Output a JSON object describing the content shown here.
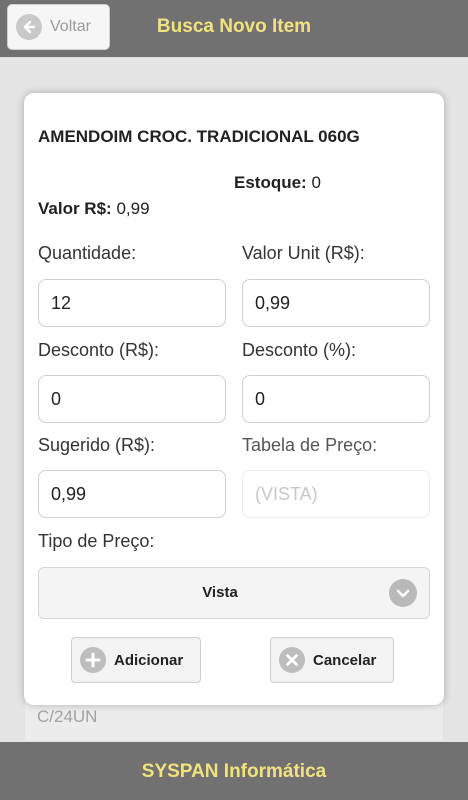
{
  "header": {
    "back_label": "Voltar",
    "title": "Busca Novo Item"
  },
  "background": {
    "card_text": "C/24UN"
  },
  "dialog": {
    "product_name": "AMENDOIM CROC. TRADICIONAL 060G",
    "stock_label": "Estoque:",
    "stock_value": "0",
    "price_label": "Valor R$:",
    "price_value": "0,99",
    "fields": {
      "quantidade": {
        "label": "Quantidade:",
        "value": "12"
      },
      "valor_unit": {
        "label": "Valor Unit (R$):",
        "value": "0,99"
      },
      "desconto_rs": {
        "label": "Desconto (R$):",
        "value": "0"
      },
      "desconto_pct": {
        "label": "Desconto (%):",
        "value": "0"
      },
      "sugerido": {
        "label": "Sugerido (R$):",
        "value": "0,99"
      },
      "tabela_preco": {
        "label": "Tabela de Preço:",
        "value": "(VISTA)"
      }
    },
    "tipo_preco": {
      "label": "Tipo de Preço:",
      "selected": "Vista"
    },
    "buttons": {
      "add_label": "Adicionar",
      "cancel_label": "Cancelar"
    }
  },
  "footer": {
    "text": "SYSPAN Informática"
  },
  "colors": {
    "header_bg": "#717171",
    "accent_text": "#f1e27a",
    "dialog_bg": "#ffffff"
  }
}
